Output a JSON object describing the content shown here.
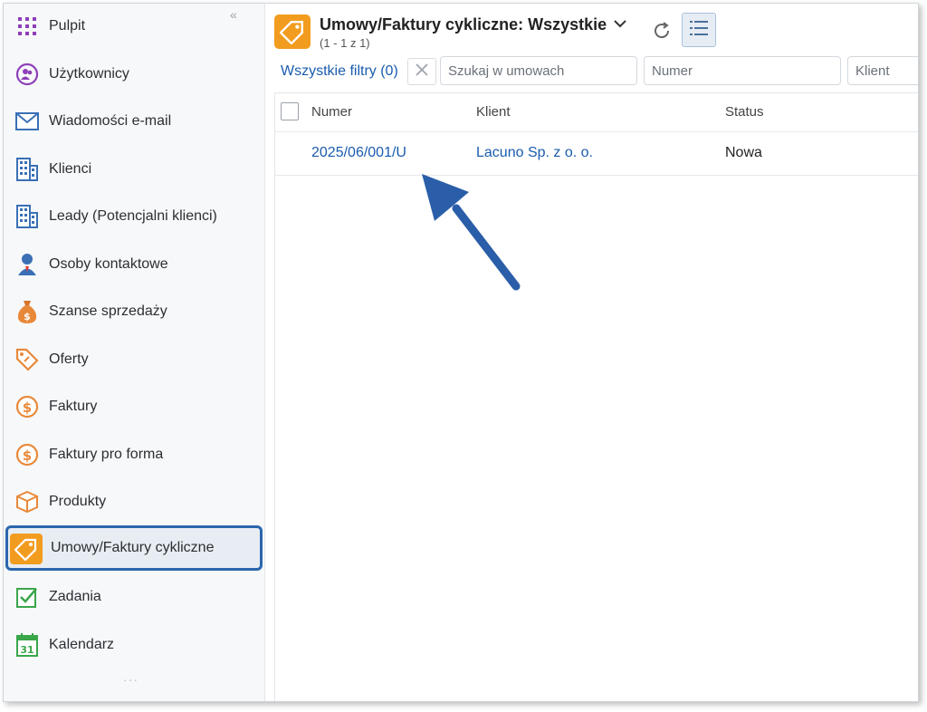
{
  "sidebar": {
    "collapse_glyph": "«",
    "items": [
      {
        "label": "Pulpit",
        "icon": "grid-icon"
      },
      {
        "label": "Użytkownicy",
        "icon": "users-icon"
      },
      {
        "label": "Wiadomości e-mail",
        "icon": "envelope-icon"
      },
      {
        "label": "Klienci",
        "icon": "building-icon"
      },
      {
        "label": "Leady (Potencjalni klienci)",
        "icon": "building-icon"
      },
      {
        "label": "Osoby kontaktowe",
        "icon": "person-icon"
      },
      {
        "label": "Szanse sprzedaży",
        "icon": "money-bag-icon"
      },
      {
        "label": "Oferty",
        "icon": "tag-icon"
      },
      {
        "label": "Faktury",
        "icon": "dollar-circle-icon"
      },
      {
        "label": "Faktury pro forma",
        "icon": "dollar-circle-icon"
      },
      {
        "label": "Produkty",
        "icon": "box-icon"
      },
      {
        "label": "Umowy/Faktury cykliczne",
        "icon": "contract-tag-icon",
        "active": true
      },
      {
        "label": "Zadania",
        "icon": "checkbox-icon"
      },
      {
        "label": "Kalendarz",
        "icon": "calendar-icon",
        "calendar_day": "31"
      }
    ],
    "more": "···"
  },
  "header": {
    "title": "Umowy/Faktury cykliczne: Wszystkie",
    "subtitle": "(1 - 1 z 1)"
  },
  "filters": {
    "all_filters_label": "Wszystkie filtry (0)",
    "search_placeholder": "Szukaj w umowach",
    "number_placeholder": "Numer",
    "client_placeholder": "Klient"
  },
  "table": {
    "columns": [
      "Numer",
      "Klient",
      "Status"
    ],
    "rows": [
      {
        "number": "2025/06/001/U",
        "client": "Lacuno Sp. z o. o.",
        "status": "Nowa"
      }
    ]
  },
  "colors": {
    "accent_blue": "#1a5cae",
    "highlight_border": "#2b66ad",
    "module_orange": "#f29c1f",
    "annotation_arrow": "#2b5ea8"
  }
}
